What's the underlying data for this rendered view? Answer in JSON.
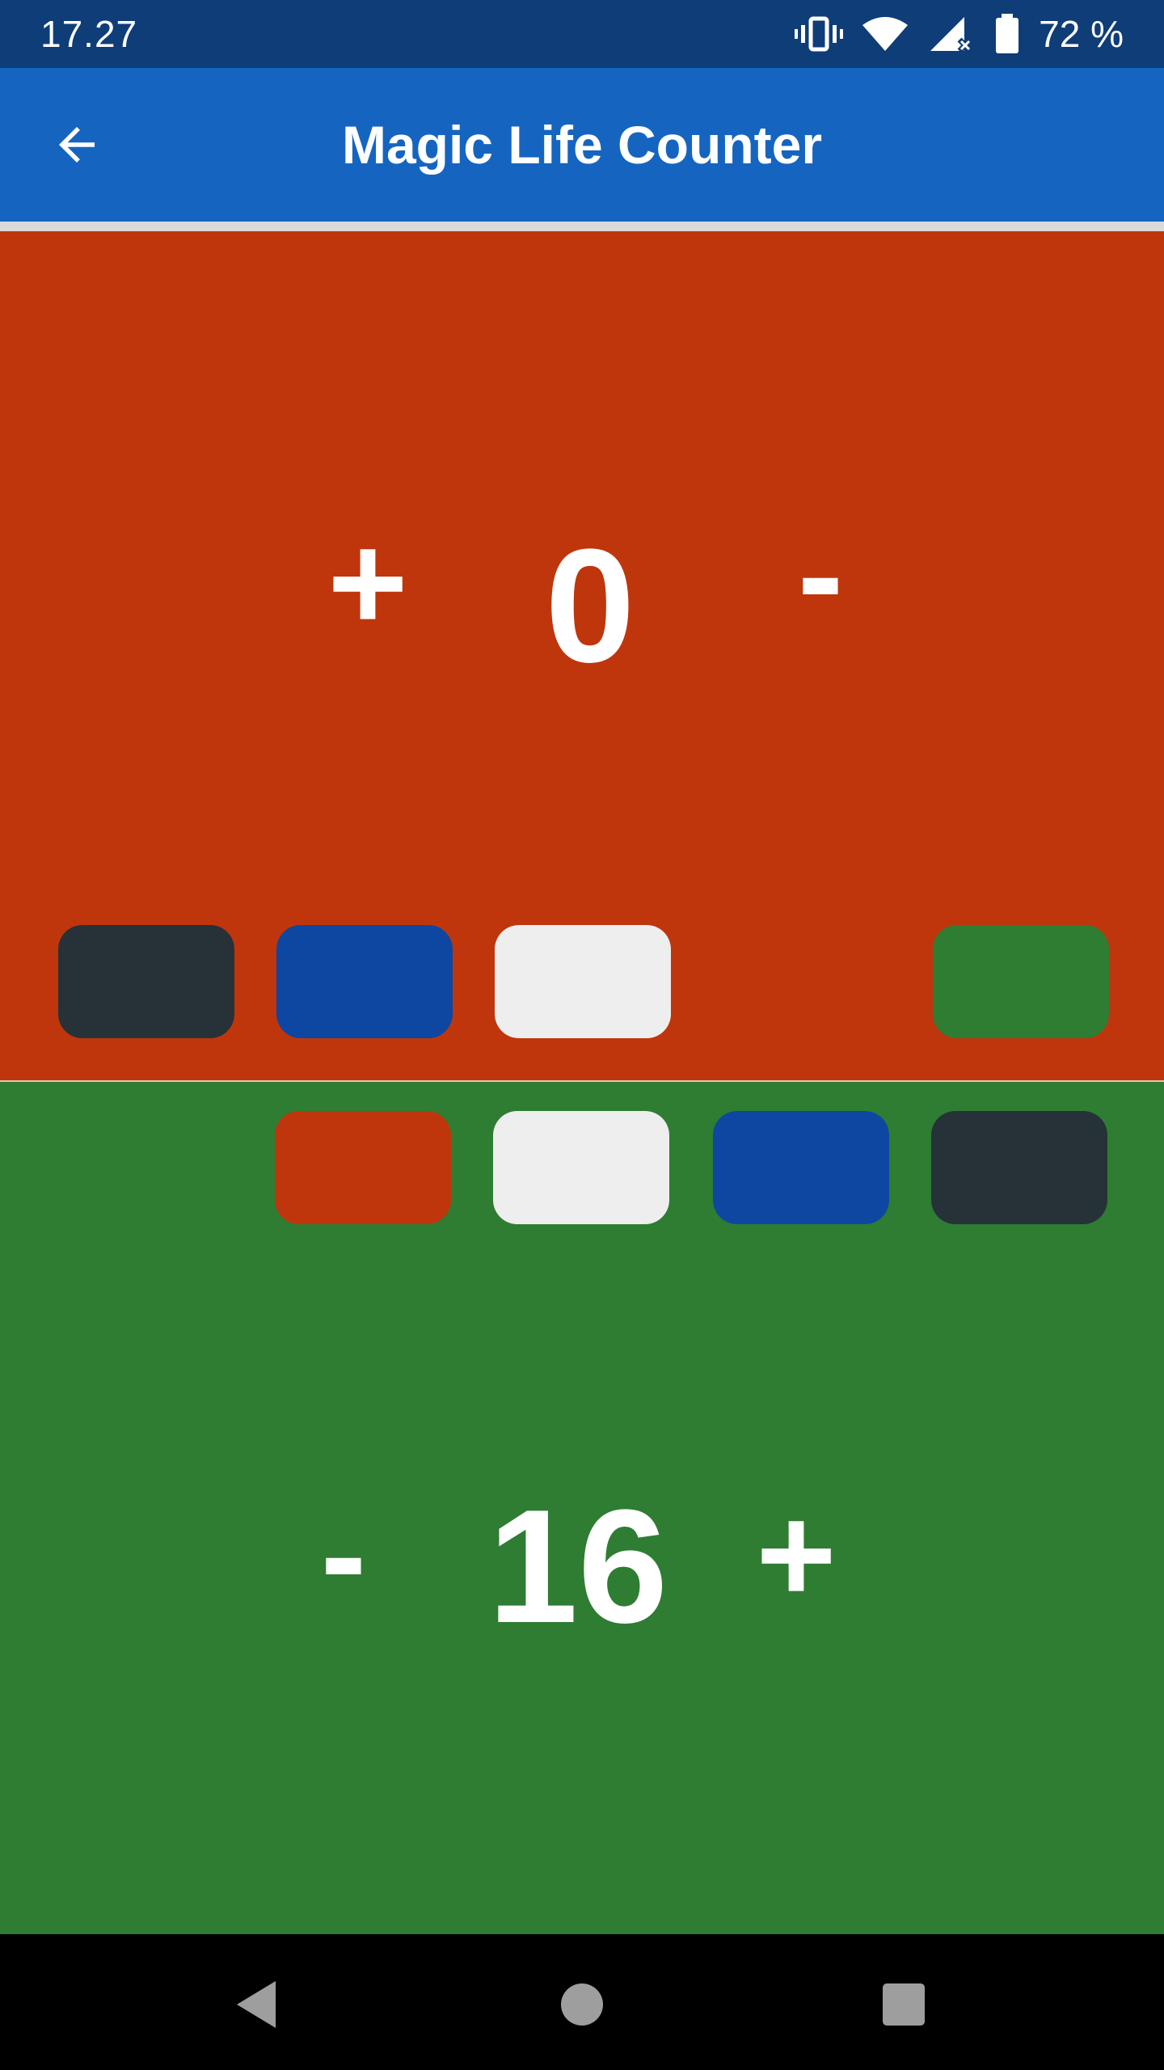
{
  "status_bar": {
    "time": "17.27",
    "battery": "72 %",
    "icons": [
      "vibrate-icon",
      "wifi-icon",
      "signal-icon",
      "battery-icon"
    ]
  },
  "app_bar": {
    "title": "Magic Life Counter",
    "back_icon": "arrow-back-icon",
    "color": "#1565c0"
  },
  "players": [
    {
      "id": "player-top",
      "background": "#bf360c",
      "life": "0",
      "plus_label": "+",
      "minus_label": "-",
      "color_swatches": [
        {
          "name": "black",
          "color": "#263238"
        },
        {
          "name": "blue",
          "color": "#0d47a1"
        },
        {
          "name": "white",
          "color": "#eeeeee"
        },
        {
          "name": "green",
          "color": "#2e7d32"
        }
      ]
    },
    {
      "id": "player-bottom",
      "background": "#2e7d32",
      "life": "16",
      "plus_label": "+",
      "minus_label": "-",
      "color_swatches": [
        {
          "name": "red",
          "color": "#bf360c"
        },
        {
          "name": "white",
          "color": "#eeeeee"
        },
        {
          "name": "blue",
          "color": "#0d47a1"
        },
        {
          "name": "black",
          "color": "#263238"
        }
      ]
    }
  ],
  "nav_bar": {
    "buttons": [
      "back-triangle-icon",
      "home-circle-icon",
      "recents-square-icon"
    ]
  }
}
